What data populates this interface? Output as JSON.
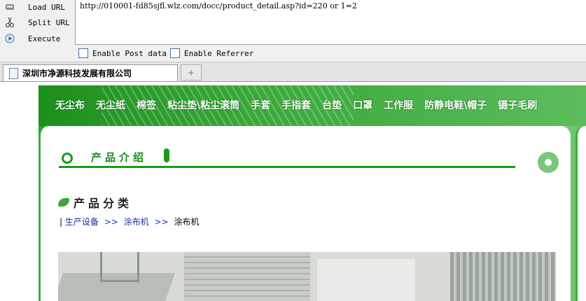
{
  "hackbar": {
    "load_url_label": "Load URL",
    "split_url_label": "Split URL",
    "execute_label": "Execute",
    "url_value": "http://010001-fd85sjfl.wlz.com/docc/product_detail.asp?id=220 or 1=2",
    "enable_post_label": "Enable Post data",
    "enable_referrer_label": "Enable Referrer"
  },
  "tabs": {
    "active_title": "深圳市净源科技发展有限公司",
    "new_tab_icon": "+"
  },
  "nav": {
    "items": [
      "无尘布",
      "无尘纸",
      "棉签",
      "粘尘垫\\粘尘滚筒",
      "手套",
      "手指套",
      "台垫",
      "口罩",
      "工作服",
      "防静电鞋\\帽子",
      "镊子毛刷"
    ]
  },
  "section": {
    "title": "产品介绍"
  },
  "category": {
    "title": "产品分类"
  },
  "breadcrumb": {
    "bar": "|",
    "level1": "生产设备",
    "sep1": ">>",
    "level2": "涂布机",
    "sep2": ">>",
    "level3": "涂布机"
  },
  "colors": {
    "brand_green": "#1a9a1a",
    "link_blue": "#1530a0"
  }
}
